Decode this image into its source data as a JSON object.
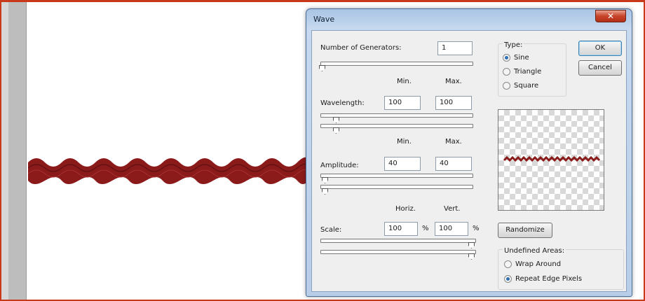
{
  "dialog": {
    "title": "Wave",
    "close_icon": "close-icon",
    "generators": {
      "label": "Number of Generators:",
      "value": "1"
    },
    "min_header": "Min.",
    "max_header": "Max.",
    "wavelength": {
      "label": "Wavelength:",
      "min": "100",
      "max": "100"
    },
    "amplitude": {
      "label": "Amplitude:",
      "min": "40",
      "max": "40"
    },
    "horiz_header": "Horiz.",
    "vert_header": "Vert.",
    "scale": {
      "label": "Scale:",
      "horiz": "100",
      "vert": "100",
      "unit": "%"
    },
    "type": {
      "title": "Type:",
      "options": [
        "Sine",
        "Triangle",
        "Square"
      ],
      "selected": "Sine"
    },
    "ok_label": "OK",
    "cancel_label": "Cancel",
    "randomize_label": "Randomize",
    "undefined_areas": {
      "title": "Undefined Areas:",
      "options": [
        "Wrap Around",
        "Repeat Edge Pixels"
      ],
      "selected": "Repeat Edge Pixels"
    }
  },
  "colors": {
    "wave": "#8b1a1a",
    "frame": "#c8381a",
    "accent": "#2f6fb0"
  }
}
